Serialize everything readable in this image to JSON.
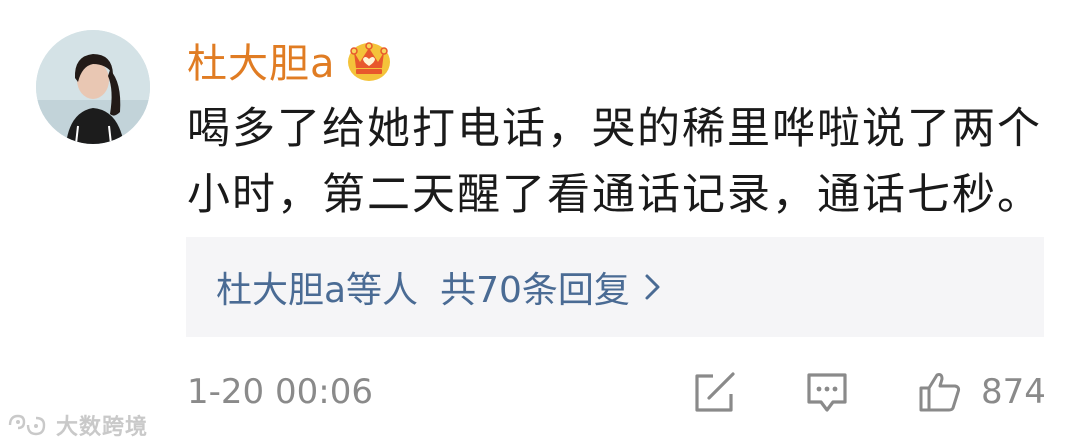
{
  "comment": {
    "username": "杜大胆a",
    "text": "喝多了给她打电话，哭的稀里哗啦说了两个小时，第二天醒了看通话记录，通话七秒。",
    "badge_icon": "vip-crown-icon",
    "accent_color": "#e07c23"
  },
  "replies": {
    "users_label": "杜大胆a等人",
    "count_label": "共70条回复",
    "link_color": "#4a6b94"
  },
  "footer": {
    "timestamp": "1-20 00:06",
    "like_count": "874"
  },
  "watermark": {
    "text": "大数跨境"
  }
}
